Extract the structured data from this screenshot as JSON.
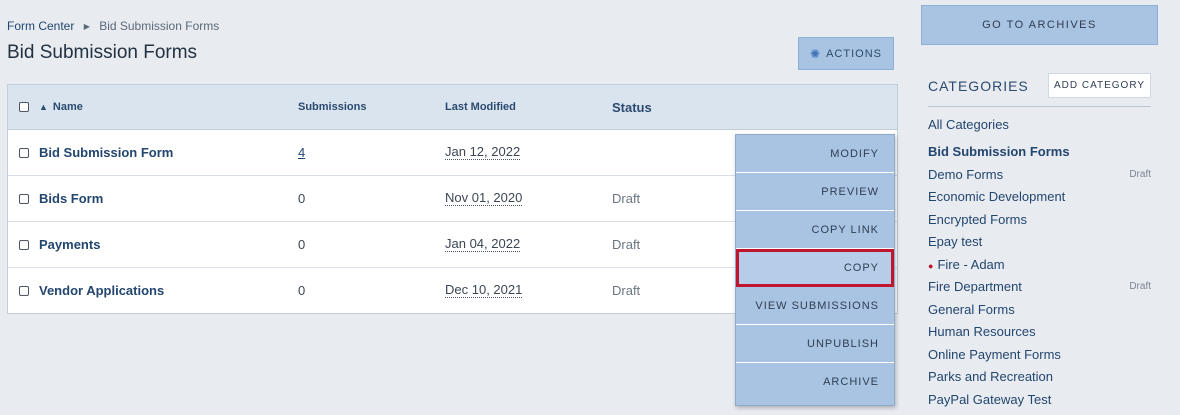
{
  "breadcrumb": {
    "root": "Form Center",
    "current": "Bid Submission Forms"
  },
  "page_title": "Bid Submission Forms",
  "actions_label": "ACTIONS",
  "table": {
    "headers": {
      "name": "Name",
      "submissions": "Submissions",
      "modified": "Last Modified",
      "status": "Status"
    },
    "rows": [
      {
        "name": "Bid Submission Form",
        "submissions": "4",
        "modified": "Jan 12, 2022",
        "status": ""
      },
      {
        "name": "Bids Form",
        "submissions": "0",
        "modified": "Nov 01, 2020",
        "status": "Draft"
      },
      {
        "name": "Payments",
        "submissions": "0",
        "modified": "Jan 04, 2022",
        "status": "Draft"
      },
      {
        "name": "Vendor Applications",
        "submissions": "0",
        "modified": "Dec 10, 2021",
        "status": "Draft"
      }
    ]
  },
  "dropdown": {
    "items": [
      "MODIFY",
      "PREVIEW",
      "COPY LINK",
      "COPY",
      "VIEW SUBMISSIONS",
      "UNPUBLISH",
      "ARCHIVE"
    ],
    "highlight_color": "#c0152f"
  },
  "sidebar": {
    "archives_label": "GO TO ARCHIVES",
    "categories_title": "CATEGORIES",
    "add_category_label": "ADD CATEGORY",
    "categories": [
      {
        "label": "All Categories",
        "tag": ""
      },
      {
        "label": "Bid Submission Forms",
        "tag": ""
      },
      {
        "label": "Demo Forms",
        "tag": "Draft"
      },
      {
        "label": "Economic Development",
        "tag": ""
      },
      {
        "label": "Encrypted Forms",
        "tag": ""
      },
      {
        "label": "Epay test",
        "tag": ""
      },
      {
        "label": "Fire - Adam",
        "tag": ""
      },
      {
        "label": "Fire Department",
        "tag": "Draft"
      },
      {
        "label": "General Forms",
        "tag": ""
      },
      {
        "label": "Human Resources",
        "tag": ""
      },
      {
        "label": "Online Payment Forms",
        "tag": ""
      },
      {
        "label": "Parks and Recreation",
        "tag": ""
      },
      {
        "label": "PayPal Gateway Test",
        "tag": ""
      }
    ]
  },
  "colors": {
    "accent": "#a9c3e2",
    "link": "#23466e",
    "background": "#e8ecf1"
  }
}
